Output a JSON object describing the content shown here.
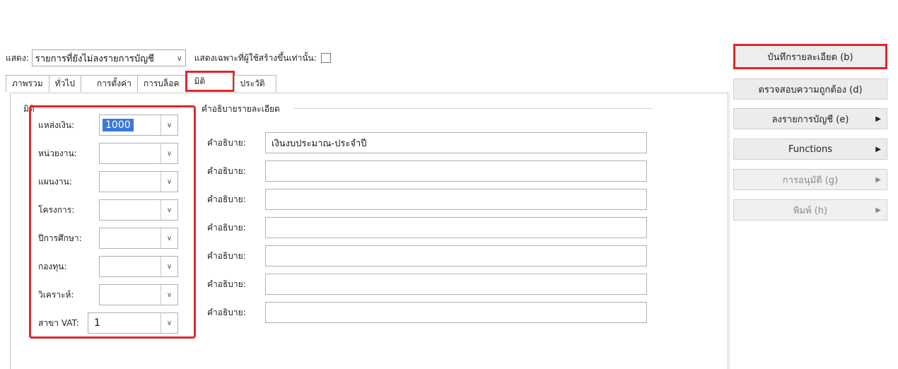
{
  "toolbar": {
    "show_label": "แสดง:",
    "show_value": "รายการที่ยังไม่ลงรายการบัญชี",
    "own_only_label": "แสดงเฉพาะที่ผู้ใช้สร้างขึ้นเท่านั้น:"
  },
  "tabs": [
    {
      "label": "ภาพรวม"
    },
    {
      "label": "ทั่วไป"
    },
    {
      "label": "การตั้งค่า"
    },
    {
      "label": "การบล็อค"
    },
    {
      "label": "มิติ",
      "active": true
    },
    {
      "label": "ประวัติ"
    }
  ],
  "panel": {
    "dimensions_title": "มิติ",
    "descriptions_title": "คำอธิบายรายละเอียด",
    "dimensions": [
      {
        "label": "แหล่งเงิน:",
        "value": "1000",
        "description_label": "คำอธิบาย:",
        "description": "เงินงบประมาณ-ประจำปี"
      },
      {
        "label": "หน่วยงาน:",
        "value": "",
        "description_label": "คำอธิบาย:",
        "description": ""
      },
      {
        "label": "แผนงาน:",
        "value": "",
        "description_label": "คำอธิบาย:",
        "description": ""
      },
      {
        "label": "โครงการ:",
        "value": "",
        "description_label": "คำอธิบาย:",
        "description": ""
      },
      {
        "label": "ปีการศึกษา:",
        "value": "",
        "description_label": "คำอธิบาย:",
        "description": ""
      },
      {
        "label": "กองทุน:",
        "value": "",
        "description_label": "คำอธิบาย:",
        "description": ""
      },
      {
        "label": "วิเคราะห์:",
        "value": "",
        "description_label": "คำอธิบาย:",
        "description": ""
      },
      {
        "label": "สาขา VAT:",
        "value": "1"
      }
    ]
  },
  "actions": [
    {
      "label": "บันทึกรายละเอียด (b)",
      "highlight": true
    },
    {
      "label": "ตรวจสอบความถูกต้อง (d)"
    },
    {
      "label": "ลงรายการบัญชี (e)",
      "submenu": true
    },
    {
      "label": "Functions",
      "submenu": true
    },
    {
      "label": "การอนุมัติ (g)",
      "submenu": true,
      "disabled": true
    },
    {
      "label": "พิมพ์ (h)",
      "submenu": true,
      "disabled": true
    }
  ],
  "colors": {
    "highlight": "#e0262d",
    "selection": "#3b78d8"
  }
}
